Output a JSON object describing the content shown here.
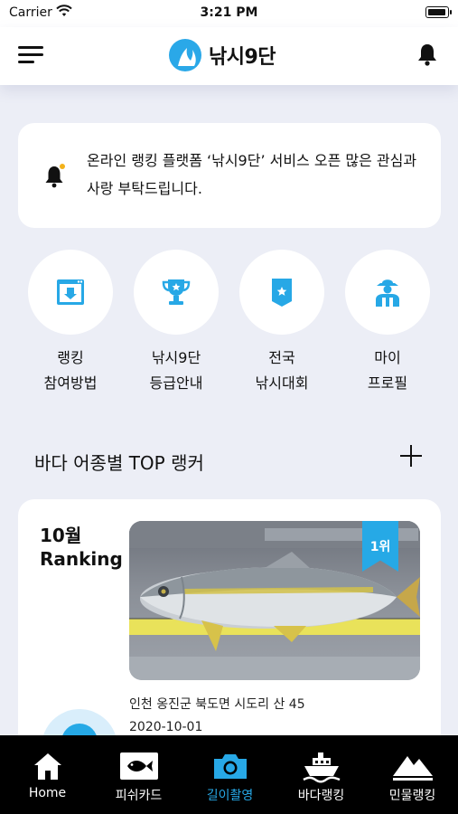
{
  "status_bar": {
    "carrier": "Carrier",
    "time": "3:21 PM"
  },
  "header": {
    "logo_text": "낚시9단",
    "icons": [
      "menu-icon",
      "logo-icon",
      "bell-icon"
    ]
  },
  "notice": {
    "text": "온라인 랭킹 플랫폼 ‘낚시9단’ 서비스 오픈 많은 관심과 사랑 부탁드립니다.",
    "icon": "bell-icon"
  },
  "quick_menu": [
    {
      "line1": "랭킹",
      "line2": "참여방법",
      "icon": "download-board-icon"
    },
    {
      "line1": "낚시9단",
      "line2": "등급안내",
      "icon": "trophy-icon"
    },
    {
      "line1": "전국",
      "line2": "낚시대회",
      "icon": "badge-icon"
    },
    {
      "line1": "마이",
      "line2": "프로필",
      "icon": "angler-icon"
    }
  ],
  "section": {
    "title": "바다 어종별 TOP 랭커"
  },
  "ranking": {
    "month": "10월",
    "title": "Ranking",
    "badge": "1위",
    "location": "인천 옹진군 북도면 시도리 산 45",
    "date": "2020-10-01"
  },
  "tabbar": {
    "tabs": [
      {
        "label": "Home",
        "icon": "home-icon"
      },
      {
        "label": "피쉬카드",
        "icon": "fish-card-icon"
      },
      {
        "label": "길이촬영",
        "icon": "camera-icon"
      },
      {
        "label": "바다랭킹",
        "icon": "ship-icon"
      },
      {
        "label": "민물랭킹",
        "icon": "mountain-icon"
      }
    ],
    "active_index": 2
  },
  "colors": {
    "accent": "#27a8e6",
    "background": "#eceef6",
    "tabbar": "#000000"
  }
}
